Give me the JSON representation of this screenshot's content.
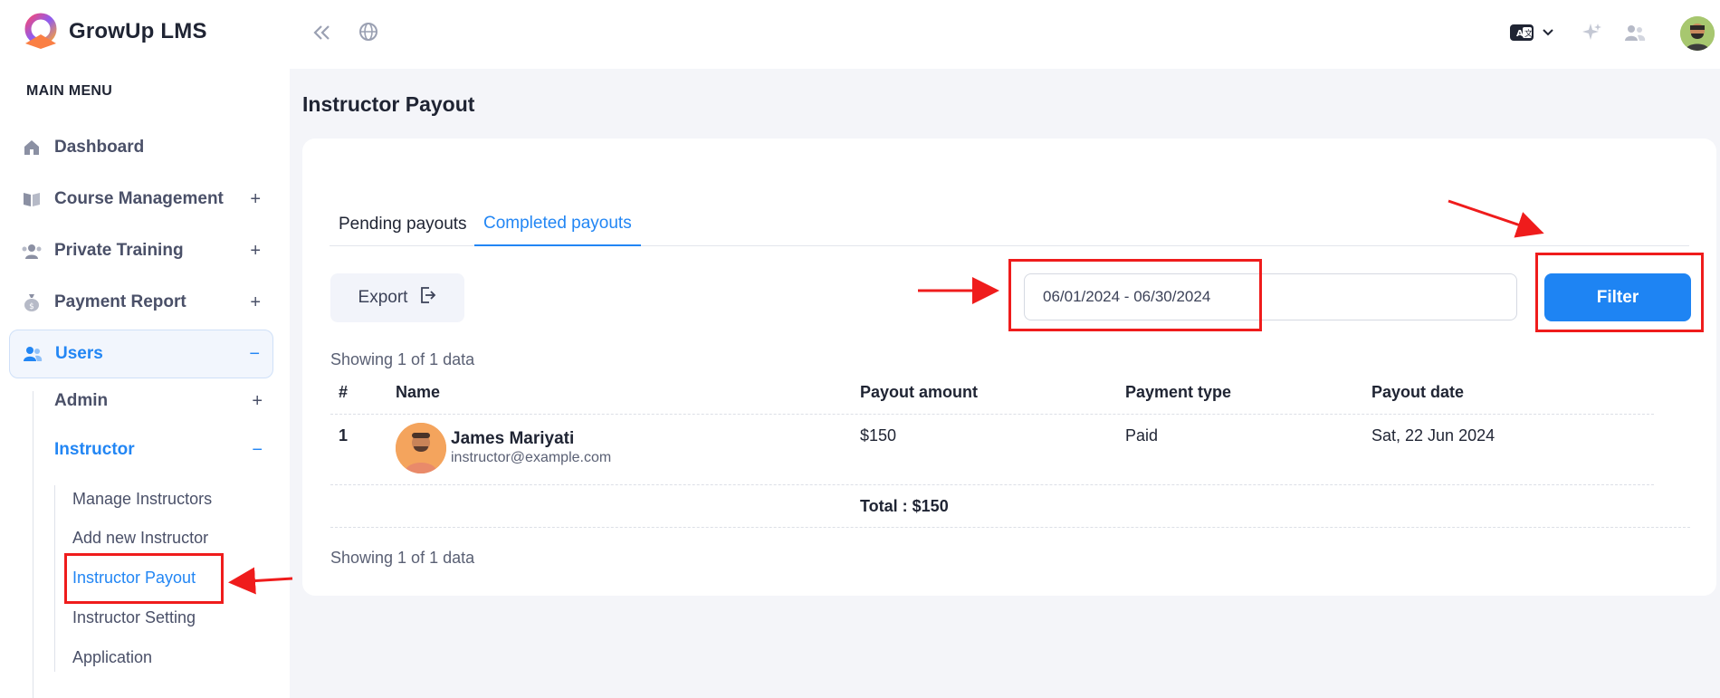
{
  "app": {
    "name": "GrowUp LMS"
  },
  "sidebar": {
    "heading": "MAIN MENU",
    "items": [
      {
        "label": "Dashboard",
        "icon": "home-icon",
        "toggle": ""
      },
      {
        "label": "Course Management",
        "icon": "book-icon",
        "toggle": "+"
      },
      {
        "label": "Private Training",
        "icon": "training-icon",
        "toggle": "+"
      },
      {
        "label": "Payment Report",
        "icon": "money-bag-icon",
        "toggle": "+"
      },
      {
        "label": "Users",
        "icon": "users-icon",
        "toggle": "−"
      }
    ],
    "users_children": [
      {
        "label": "Admin",
        "toggle": "+"
      },
      {
        "label": "Instructor",
        "toggle": "−"
      }
    ],
    "instructor_children": [
      {
        "label": "Manage Instructors"
      },
      {
        "label": "Add new Instructor"
      },
      {
        "label": "Instructor Payout"
      },
      {
        "label": "Instructor Setting"
      },
      {
        "label": "Application"
      }
    ]
  },
  "topbar": {
    "icons": [
      "collapse-sidebar-icon",
      "globe-icon",
      "language-translate-icon",
      "chevron-down-icon",
      "sparkle-icon",
      "user-switch-icon",
      "user-avatar"
    ]
  },
  "page": {
    "title": "Instructor Payout"
  },
  "tabs": [
    {
      "label": "Pending payouts",
      "active": false
    },
    {
      "label": "Completed payouts",
      "active": true
    }
  ],
  "toolbar": {
    "export_label": "Export",
    "date_range_value": "06/01/2024 - 06/30/2024",
    "filter_label": "Filter"
  },
  "table": {
    "showing_top": "Showing 1 of 1 data",
    "showing_bottom": "Showing 1 of 1 data",
    "headers": [
      "#",
      "Name",
      "Payout amount",
      "Payment type",
      "Payout date"
    ],
    "rows": [
      {
        "index": "1",
        "name": "James Mariyati",
        "email": "instructor@example.com",
        "payout_amount": "$150",
        "payment_type": "Paid",
        "payout_date": "Sat, 22 Jun 2024"
      }
    ],
    "total": "Total : $150"
  },
  "colors": {
    "accent": "#2286f4",
    "annotation": "#ef1c1c"
  }
}
